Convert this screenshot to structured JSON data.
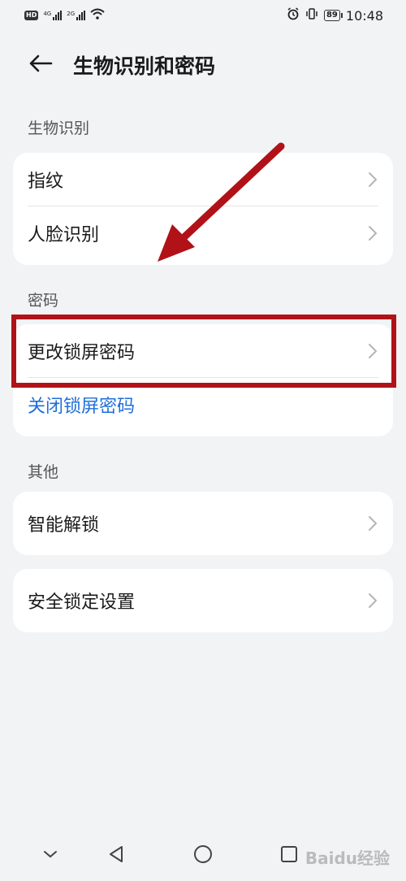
{
  "status_bar": {
    "hd_label": "HD",
    "signal1_tag": "4G",
    "signal2_tag": "2G",
    "battery": "89",
    "time": "10:48"
  },
  "header": {
    "title": "生物识别和密码"
  },
  "sections": {
    "biometrics": {
      "label": "生物识别",
      "items": [
        {
          "label": "指纹"
        },
        {
          "label": "人脸识别"
        }
      ]
    },
    "password": {
      "label": "密码",
      "items": [
        {
          "label": "更改锁屏密码"
        },
        {
          "label": "关闭锁屏密码"
        }
      ]
    },
    "other": {
      "label": "其他",
      "items": [
        {
          "label": "智能解锁"
        }
      ]
    },
    "security": {
      "items": [
        {
          "label": "安全锁定设置"
        }
      ]
    }
  },
  "annotation": {
    "arrow_color": "#b01218",
    "box_color": "#b01218"
  },
  "watermark": "Baidu经验",
  "colors": {
    "link_blue": "#1e6fd8",
    "background": "#f1f3f5"
  }
}
